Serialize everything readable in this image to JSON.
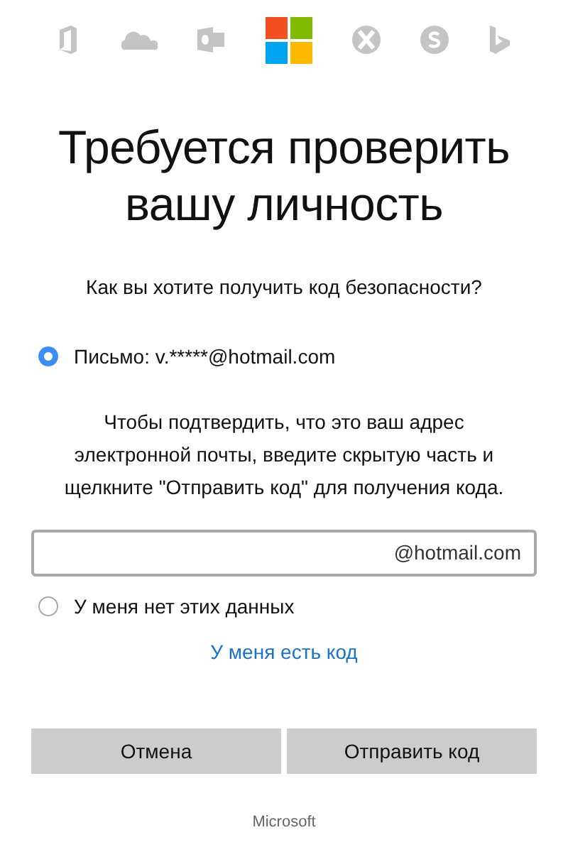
{
  "title": "Требуется проверить вашу личность",
  "question": "Как вы хотите получить код безопасности?",
  "options": [
    {
      "label": "Письмо: v.*****@hotmail.com",
      "selected": true
    }
  ],
  "instructions": "Чтобы подтвердить, что это ваш адрес электронной почты, введите скрытую часть и щелкните \"Отправить код\" для получения кода.",
  "email_field": {
    "suffix": "@hotmail.com"
  },
  "alt_option": {
    "label": "У меня нет этих данных",
    "selected": false
  },
  "code_link": "У меня есть код",
  "buttons": [
    "Отмена",
    "Отправить код"
  ],
  "footer": "Microsoft"
}
